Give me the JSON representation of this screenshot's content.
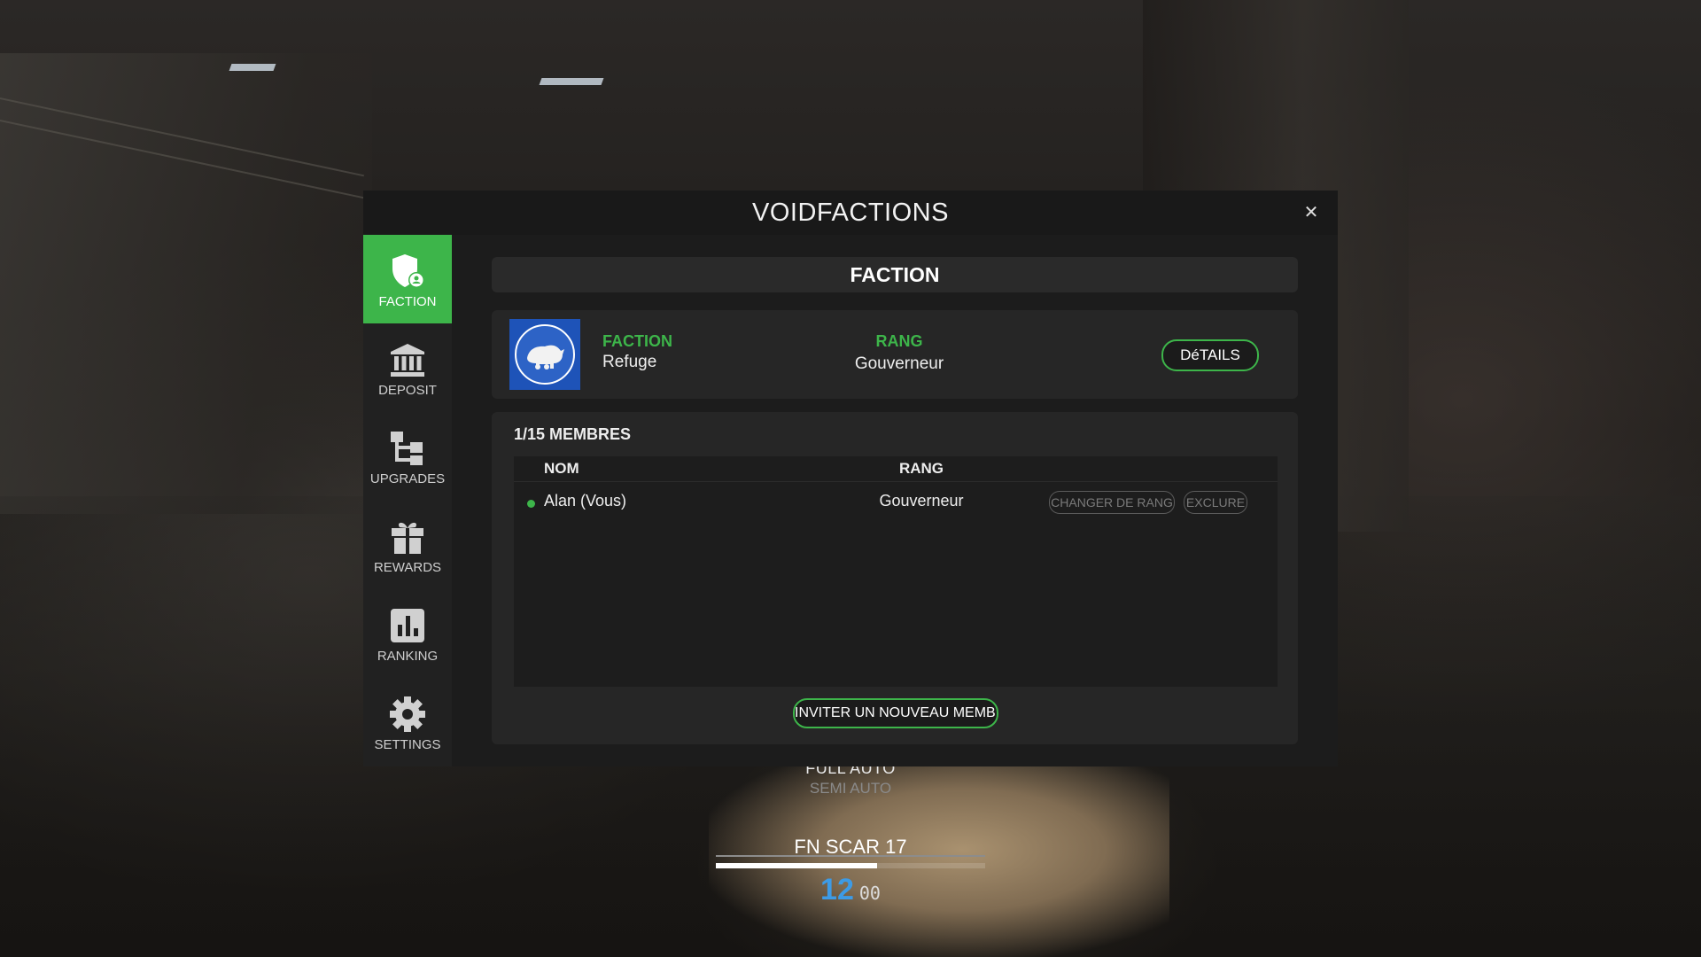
{
  "window": {
    "title": "VOIDFACTIONS",
    "close_glyph": "✕"
  },
  "sidebar": {
    "items": [
      {
        "label": "FACTION",
        "icon": "shield-user-icon",
        "active": true
      },
      {
        "label": "DEPOSIT",
        "icon": "bank-icon",
        "active": false
      },
      {
        "label": "UPGRADES",
        "icon": "upgrades-tree-icon",
        "active": false
      },
      {
        "label": "REWARDS",
        "icon": "gift-icon",
        "active": false
      },
      {
        "label": "RANKING",
        "icon": "bar-chart-icon",
        "active": false
      },
      {
        "label": "SETTINGS",
        "icon": "gear-icon",
        "active": false
      }
    ]
  },
  "main": {
    "section_title": "FACTION",
    "faction_card": {
      "faction_label": "FACTION",
      "faction_name": "Refuge",
      "rank_label": "RANG",
      "rank_value": "Gouverneur",
      "details_button": "DéTAILS"
    },
    "members": {
      "count_label": "1/15 MEMBRES",
      "columns": {
        "name": "NOM",
        "rank": "RANG"
      },
      "rows": [
        {
          "name": "Alan (Vous)",
          "rank": "Gouverneur",
          "online": true,
          "change_rank_button": "CHANGER DE RANG",
          "kick_button": "EXCLURE"
        }
      ],
      "invite_button": "INVITER UN NOUVEAU MEMBRE"
    }
  },
  "hud": {
    "fire_mode": "FULL AUTO",
    "fire_mode_alt": "SEMI AUTO",
    "weapon_name": "FN SCAR 17",
    "ammo_magazine": "12",
    "ammo_reserve": "00",
    "ammo_fill_fraction": 0.6
  },
  "colors": {
    "accent": "#3db54a",
    "ammo": "#3d9be6",
    "panel": "#1c1c1c",
    "logo_bg": "#1e53b8"
  }
}
